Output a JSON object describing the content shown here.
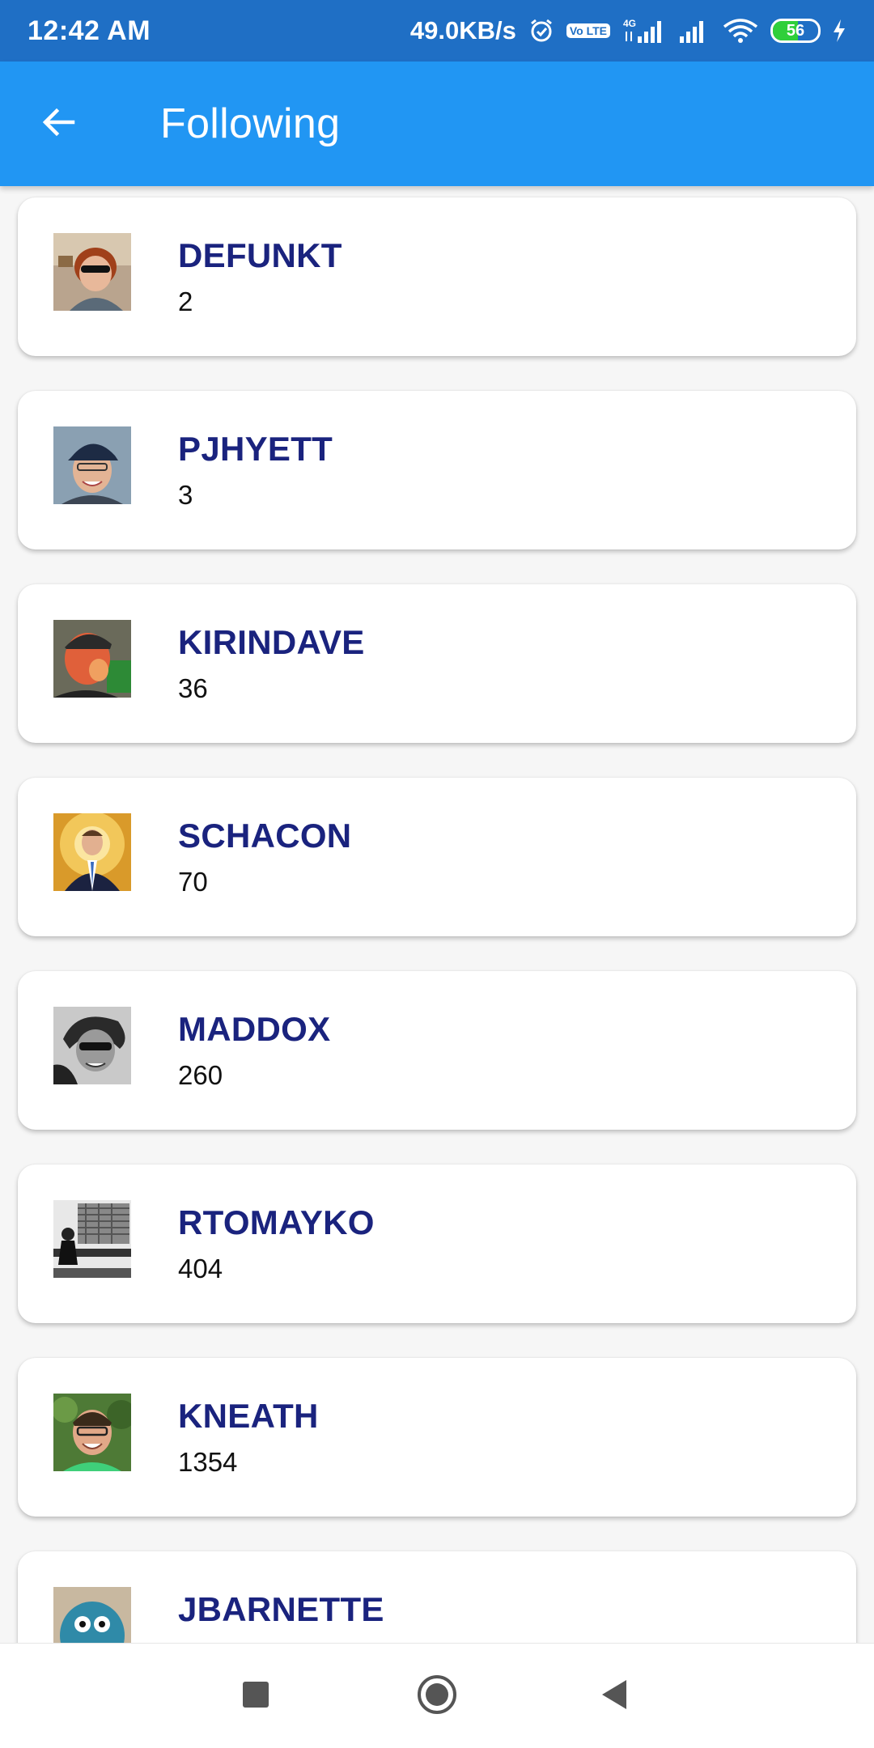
{
  "status_bar": {
    "time": "12:42 AM",
    "network_speed": "49.0KB/s",
    "volte_label": "Vo LTE",
    "network_type": "4G",
    "battery_level": "56",
    "battery_fraction": 0.56,
    "icons": [
      "alarm-icon",
      "volte-icon",
      "signal-4g-icon",
      "signal-icon",
      "wifi-icon",
      "battery-icon",
      "charging-icon"
    ]
  },
  "app_bar": {
    "title": "Following",
    "back_icon": "arrow-back-icon",
    "color": "#2196f3"
  },
  "users": [
    {
      "name": "DEFUNKT",
      "id": "2"
    },
    {
      "name": "PJHYETT",
      "id": "3"
    },
    {
      "name": "KIRINDAVE",
      "id": "36"
    },
    {
      "name": "SCHACON",
      "id": "70"
    },
    {
      "name": "MADDOX",
      "id": "260"
    },
    {
      "name": "RTOMAYKO",
      "id": "404"
    },
    {
      "name": "KNEATH",
      "id": "1354"
    },
    {
      "name": "JBARNETTE",
      "id": ""
    }
  ],
  "nav_bar": {
    "icons": [
      "recent-apps-icon",
      "home-icon",
      "back-triangle-icon"
    ]
  },
  "colors": {
    "status_bar": "#1f6fc5",
    "username": "#1a237e",
    "background": "#f6f6f6"
  }
}
